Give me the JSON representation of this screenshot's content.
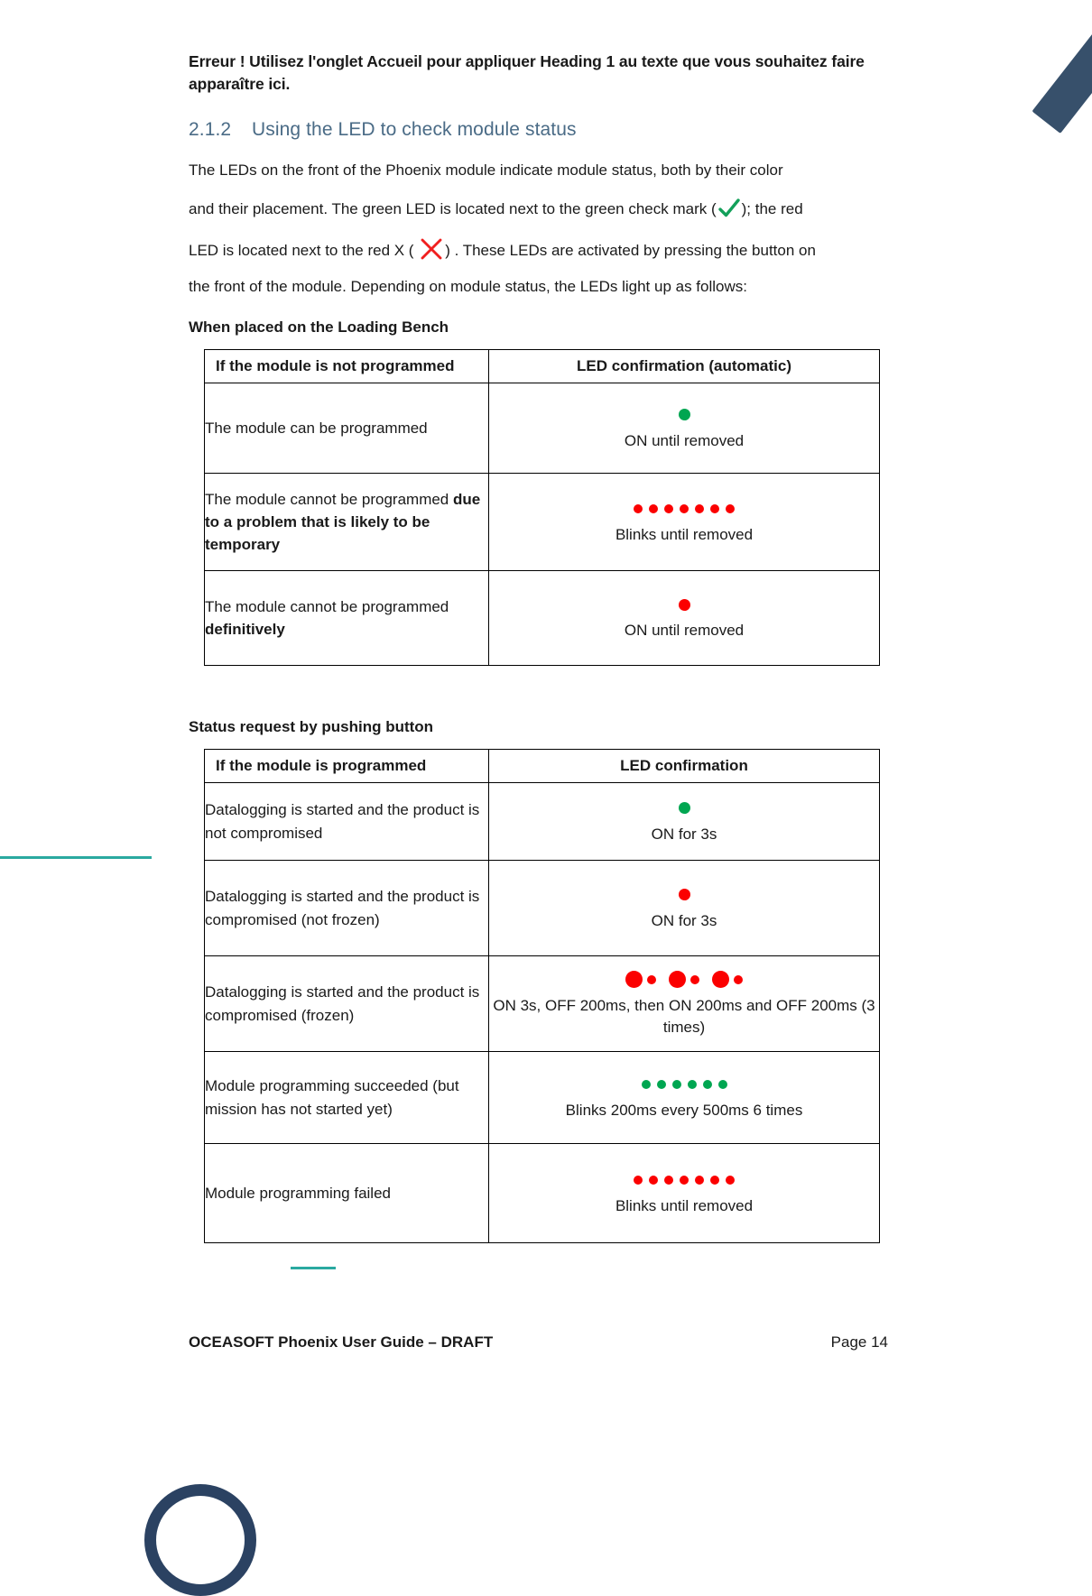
{
  "document": {
    "error_notice": "Erreur ! Utilisez l'onglet Accueil pour appliquer Heading 1 au texte que vous souhaitez faire apparaître ici.",
    "heading": {
      "number": "2.1.2",
      "title": "Using the LED to check module status"
    },
    "intro": {
      "line1": "The LEDs on the front of the Phoenix module indicate module status, both by their color",
      "line2_before": "and their placement. The green LED is located next to the green check mark (",
      "line2_after": "); the red",
      "line3_before": "LED is located next to the red X ( ",
      "line3_after": ") . These LEDs are activated by pressing the button on",
      "line4": "the front of the module. Depending on module status, the LEDs light up as follows:",
      "check_icon": "green-check-icon",
      "cross_icon": "red-x-icon"
    }
  },
  "section_loading_bench": {
    "subhead": "When placed on the Loading Bench",
    "table": {
      "headers": [
        "If the module is not programmed",
        "LED confirmation (automatic)"
      ],
      "rows": [
        {
          "condition": "The module can be programmed",
          "condition_bold": "",
          "caption": "ON until removed",
          "led": {
            "pattern": "solid",
            "color": "green",
            "count": 1
          }
        },
        {
          "condition": "The module cannot be programmed ",
          "condition_bold": "due to a problem that is likely to be temporary",
          "caption": "Blinks until removed",
          "led": {
            "pattern": "blink",
            "color": "red",
            "count": 7
          }
        },
        {
          "condition": "The module cannot be programmed ",
          "condition_bold": "definitively",
          "caption": "ON until removed",
          "led": {
            "pattern": "solid",
            "color": "red",
            "count": 1
          }
        }
      ]
    }
  },
  "section_status_request": {
    "subhead": "Status request by pushing button",
    "table": {
      "headers": [
        "If the module is programmed",
        "LED confirmation"
      ],
      "rows": [
        {
          "condition": "Datalogging is started and the product is not compromised",
          "condition_bold": "",
          "caption": "ON for 3s",
          "led": {
            "pattern": "solid",
            "color": "green",
            "count": 1
          }
        },
        {
          "condition": "Datalogging is started and the product is compromised (not frozen)",
          "condition_bold": "",
          "caption": "ON for 3s",
          "led": {
            "pattern": "solid",
            "color": "red",
            "count": 1
          }
        },
        {
          "condition": "Datalogging is started and the product is compromised (frozen)",
          "condition_bold": "",
          "caption": "ON 3s, OFF 200ms, then ON 200ms and OFF 200ms (3 times)",
          "led": {
            "pattern": "pairs",
            "color": "red",
            "count": 3
          }
        },
        {
          "condition": "Module programming succeeded (but mission has not started yet)",
          "condition_bold": "",
          "caption": "Blinks 200ms every 500ms 6 times",
          "led": {
            "pattern": "blink",
            "color": "green",
            "count": 6
          }
        },
        {
          "condition": "Module programming failed",
          "condition_bold": "",
          "caption": "Blinks until removed",
          "led": {
            "pattern": "blink",
            "color": "red",
            "count": 7
          }
        }
      ]
    }
  },
  "footer": {
    "title": "OCEASOFT Phoenix User Guide – DRAFT",
    "page_label": "Page 14"
  },
  "colors": {
    "green_led": "#00a651",
    "red_led": "#fb0000",
    "heading": "#4a6b86",
    "teal_accent": "#2aa9a0",
    "navy_accent": "#2b4262"
  }
}
